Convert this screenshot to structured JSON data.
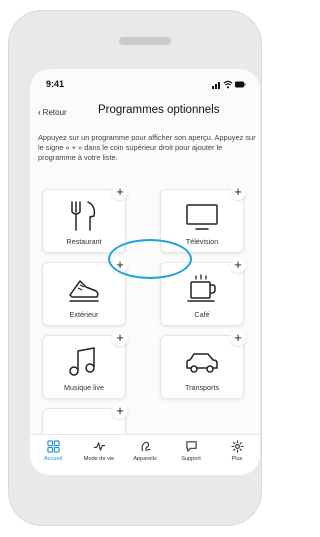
{
  "status_bar": {
    "time": "9:41"
  },
  "header": {
    "back_label": "Retour",
    "title": "Programmes optionnels"
  },
  "intro": "Appuyez sur un programme pour afficher son aperçu. Appuyez sur le signe « + » dans le coin supérieur droit pour ajouter le programme à votre liste.",
  "programs": [
    {
      "label": "Restaurant",
      "icon": "restaurant-icon",
      "add": "+"
    },
    {
      "label": "Télévision",
      "icon": "television-icon",
      "add": "+"
    },
    {
      "label": "Extérieur",
      "icon": "outdoor-shoe-icon",
      "add": "+"
    },
    {
      "label": "Café",
      "icon": "cafe-cup-icon",
      "add": "+"
    },
    {
      "label": "Musique live",
      "icon": "music-note-icon",
      "add": "+"
    },
    {
      "label": "Transports",
      "icon": "car-icon",
      "add": "+"
    },
    {
      "label": "",
      "icon": "",
      "add": "+"
    }
  ],
  "tabs": [
    {
      "label": "Accueil",
      "icon": "home-grid-icon",
      "active": true
    },
    {
      "label": "Mode de vie",
      "icon": "activity-icon",
      "active": false
    },
    {
      "label": "Appareils",
      "icon": "hearing-aids-icon",
      "active": false
    },
    {
      "label": "Support",
      "icon": "chat-bubble-icon",
      "active": false
    },
    {
      "label": "Plus",
      "icon": "gear-icon",
      "active": false
    }
  ],
  "colors": {
    "accent": "#1d8fd6",
    "highlight": "#19a3d8",
    "background": "#fbfbfb"
  }
}
